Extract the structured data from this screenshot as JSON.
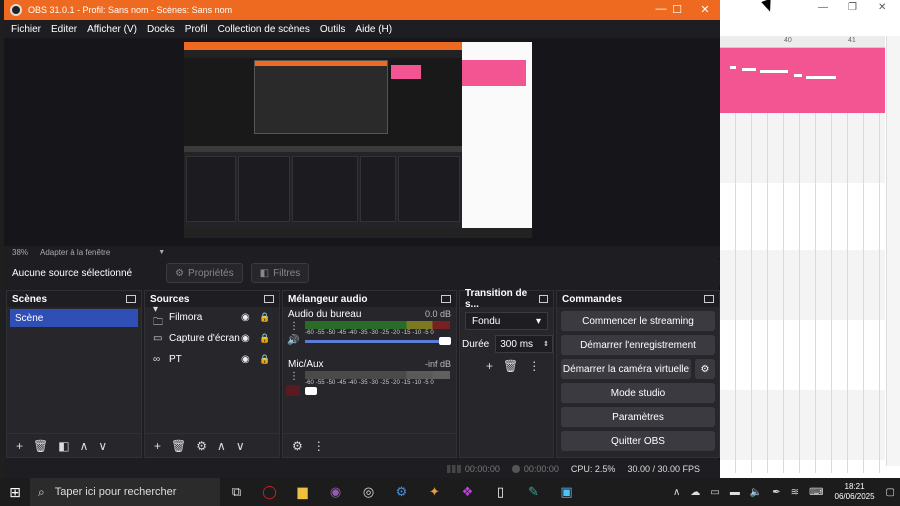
{
  "window": {
    "title": "OBS 31.0.1 - Profil: Sans nom - Scènes: Sans nom",
    "minimize": "—",
    "maximize": "☐",
    "close": "✕"
  },
  "menu": [
    "Fichier",
    "Editer",
    "Afficher (V)",
    "Docks",
    "Profil",
    "Collection de scènes",
    "Outils",
    "Aide (H)"
  ],
  "preview": {
    "zoom": "38%",
    "fit_mode": "Adapter à la fenêtre"
  },
  "source_toolbar": {
    "no_selection": "Aucune source sélectionné",
    "properties": "Propriétés",
    "filters": "Filtres"
  },
  "scenes": {
    "title": "Scènes",
    "items": [
      "Scène"
    ]
  },
  "sources": {
    "title": "Sources",
    "items": [
      {
        "label": "Filmora",
        "icon": "folder-icon"
      },
      {
        "label": "Capture d'écran",
        "icon": "monitor-icon"
      },
      {
        "label": "PT",
        "icon": "link-icon"
      }
    ]
  },
  "mixer": {
    "title": "Mélangeur audio",
    "channels": [
      {
        "name": "Audio du bureau",
        "db": "0.0 dB",
        "ticks": "-60 -55 -50 -45 -40 -35 -30 -25 -20 -15 -10 -5 0"
      },
      {
        "name": "Mic/Aux",
        "db": "-inf dB",
        "ticks": "-60 -55 -50 -45 -40 -35 -30 -25 -20 -15 -10 -5 0"
      }
    ]
  },
  "transitions": {
    "title": "Transition de s...",
    "selected": "Fondu",
    "duration_label": "Durée",
    "duration_value": "300 ms"
  },
  "commands": {
    "title": "Commandes",
    "buttons": [
      "Commencer le streaming",
      "Démarrer l'enregistrement",
      "Démarrer la caméra virtuelle",
      "Mode studio",
      "Paramètres",
      "Quitter OBS"
    ]
  },
  "status": {
    "stream_time": "00:00:00",
    "rec_time": "00:00:00",
    "cpu": "CPU: 2.5%",
    "fps": "30.00 / 30.00 FPS"
  },
  "background_app": {
    "ruler_marks": [
      "40",
      "41"
    ]
  },
  "taskbar": {
    "search_placeholder": "Taper ici pour rechercher",
    "time": "18:21",
    "date": "06/06/2025"
  },
  "colors": {
    "obs_titlebar": "#ef6a21",
    "selection": "#2f4fb5",
    "background_pink": "#f25592"
  }
}
